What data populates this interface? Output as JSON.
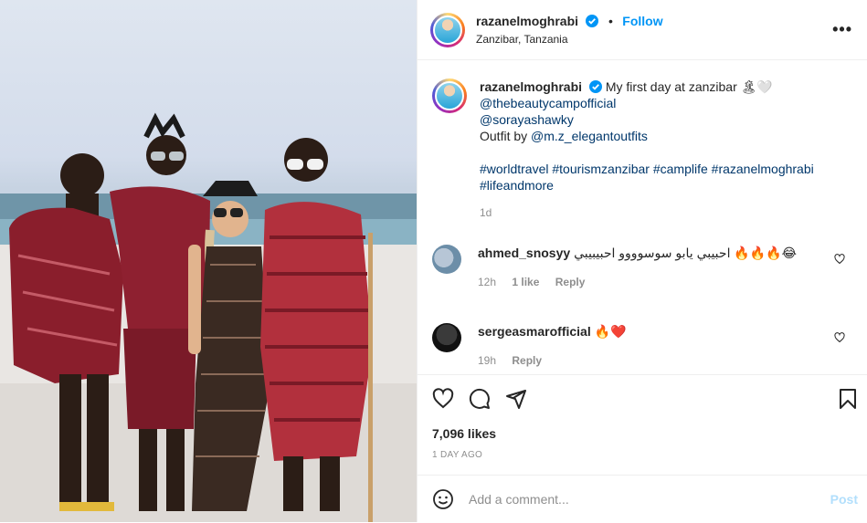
{
  "post": {
    "username": "razanelmoghrabi",
    "follow_label": "Follow",
    "location": "Zanzibar, Tanzania",
    "more_label": "•••"
  },
  "caption": {
    "username": "razanelmoghrabi",
    "text": "My first day at zanzibar 🏝🤍",
    "mention1": "@thebeautycampofficial",
    "mention2": "@sorayashawky",
    "outfit_prefix": "Outfit by ",
    "outfit_mention": "@m.z_elegantoutfits",
    "hashtags_line1": "#worldtravel #tourismzanzibar #camplife #razanelmoghrabi",
    "hashtags_line2": "#lifeandmore",
    "time": "1d"
  },
  "comments": [
    {
      "username": "ahmed_snosyy",
      "text": "احبيبي يابو سوسوووو احبيبيبي 🔥🔥🔥😂",
      "time": "12h",
      "likes": "1 like",
      "reply": "Reply"
    },
    {
      "username": "sergeasmarofficial",
      "text": "🔥❤️",
      "time": "19h",
      "reply": "Reply"
    }
  ],
  "stats": {
    "likes": "7,096 likes",
    "date": "1 DAY AGO"
  },
  "composer": {
    "placeholder": "Add a comment...",
    "post_label": "Post"
  },
  "colors": {
    "accent": "#0095f6",
    "link": "#00376b",
    "muted": "#8e8e8e",
    "post_disabled": "#b2dffc"
  },
  "icons": [
    "verified-badge-icon",
    "more-options-icon",
    "heart-icon",
    "comment-icon",
    "share-icon",
    "bookmark-icon",
    "emoji-icon"
  ]
}
